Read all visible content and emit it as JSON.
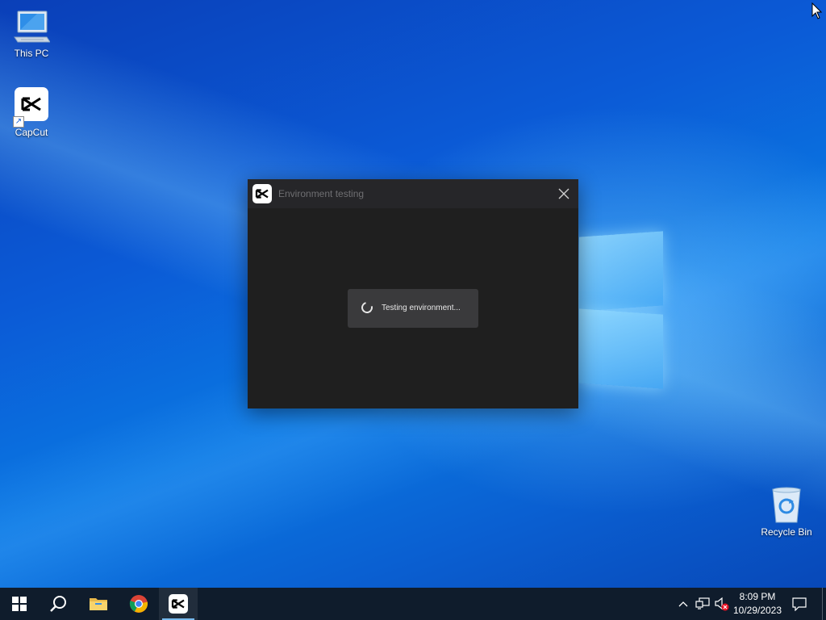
{
  "desktop": {
    "icons": [
      {
        "label": "This PC",
        "icon": "computer-icon"
      },
      {
        "label": "CapCut",
        "icon": "capcut-icon"
      },
      {
        "label": "Recycle Bin",
        "icon": "recycle-bin-icon"
      }
    ]
  },
  "dialog": {
    "title": "Environment testing",
    "status_message": "Testing environment...",
    "close_icon": "close-icon"
  },
  "taskbar": {
    "buttons": [
      {
        "name": "start",
        "icon": "windows-icon"
      },
      {
        "name": "search",
        "icon": "search-icon"
      },
      {
        "name": "file-explorer",
        "icon": "folder-icon"
      },
      {
        "name": "chrome",
        "icon": "chrome-icon"
      },
      {
        "name": "capcut",
        "icon": "capcut-icon",
        "active": true
      }
    ],
    "tray": {
      "icons": [
        "chevron-up-icon",
        "network-icon",
        "volume-muted-icon"
      ],
      "time": "8:09 PM",
      "date": "10/29/2023",
      "notification_icon": "notification-icon"
    }
  },
  "colors": {
    "taskbar_bg": "#0f1c2c",
    "dialog_bg": "#1f1f1f",
    "dialog_titlebar": "#262629",
    "accent": "#76b9ed"
  }
}
